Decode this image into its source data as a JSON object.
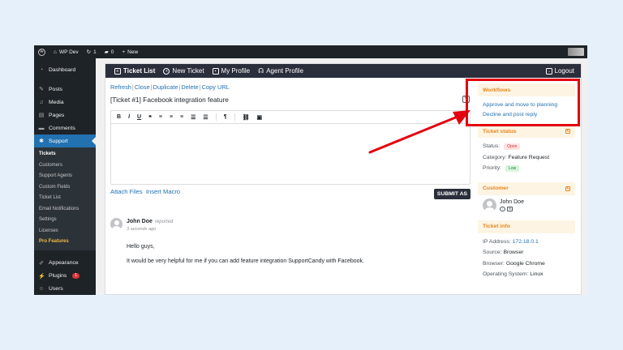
{
  "adminbar": {
    "site_name": "WP Dev",
    "updates_count": "1",
    "comments_count": "0",
    "new_label": "New"
  },
  "sidebar": {
    "top_items": [
      {
        "label": "Dashboard",
        "icon": "dashboard-icon"
      },
      {
        "label": "Posts",
        "icon": "pin-icon"
      },
      {
        "label": "Media",
        "icon": "media-icon"
      },
      {
        "label": "Pages",
        "icon": "page-icon"
      },
      {
        "label": "Comments",
        "icon": "comment-icon"
      },
      {
        "label": "Support",
        "icon": "support-icon"
      }
    ],
    "submenu": [
      "Tickets",
      "Customers",
      "Support Agents",
      "Custom Fields",
      "Ticket List",
      "Email Notifications",
      "Settings",
      "Licenses",
      "Pro Features"
    ],
    "bottom_items": [
      {
        "label": "Appearance",
        "icon": "brush-icon"
      },
      {
        "label": "Plugins",
        "icon": "plugin-icon",
        "badge": "1"
      },
      {
        "label": "Users",
        "icon": "users-icon"
      }
    ]
  },
  "topnav": {
    "ticket_list": "Ticket List",
    "new_ticket": "New Ticket",
    "my_profile": "My Profile",
    "agent_profile": "Agent Profile",
    "logout": "Logout"
  },
  "actions": [
    "Refresh",
    "Close",
    "Duplicate",
    "Delete",
    "Copy URL"
  ],
  "ticket": {
    "title": "[Ticket #1] Facebook integration feature"
  },
  "editor": {
    "toolbar": [
      "B",
      "I",
      "U",
      "❝",
      "≡",
      "≡",
      "≡",
      "☰",
      "☰",
      "¶",
      "⛓",
      "▣"
    ],
    "attach_files": "Attach Files",
    "insert_macro": "Insert Macro",
    "submit_label": "SUBMIT AS"
  },
  "thread": {
    "author": "John Doe",
    "action": "reported",
    "time": "3 seconds ago",
    "line1": "Hello guys,",
    "line2": "It would be very helpful for me if you can add feature integration SupportCandy with Facebook."
  },
  "workflows": {
    "title": "Workflows",
    "items": [
      "Approve and move to planning",
      "Decline and post reply"
    ]
  },
  "ticket_status": {
    "title": "Ticket status",
    "status_label": "Status:",
    "status_value": "Open",
    "category_label": "Category:",
    "category_value": "Feature Request",
    "priority_label": "Priority:",
    "priority_value": "Low"
  },
  "customer": {
    "title": "Customer",
    "name": "John Doe"
  },
  "ticket_info": {
    "title": "Ticket info",
    "ip_label": "IP Address:",
    "ip_value": "172.18.0.1",
    "source_label": "Source:",
    "source_value": "Browser",
    "browser_label": "Browser:",
    "browser_value": "Google Chrome",
    "os_label": "Operating System:",
    "os_value": "Linux"
  },
  "colors": {
    "accent_blue": "#2271b1",
    "highlight_red": "#e3000f",
    "widget_orange": "#e5861f"
  }
}
